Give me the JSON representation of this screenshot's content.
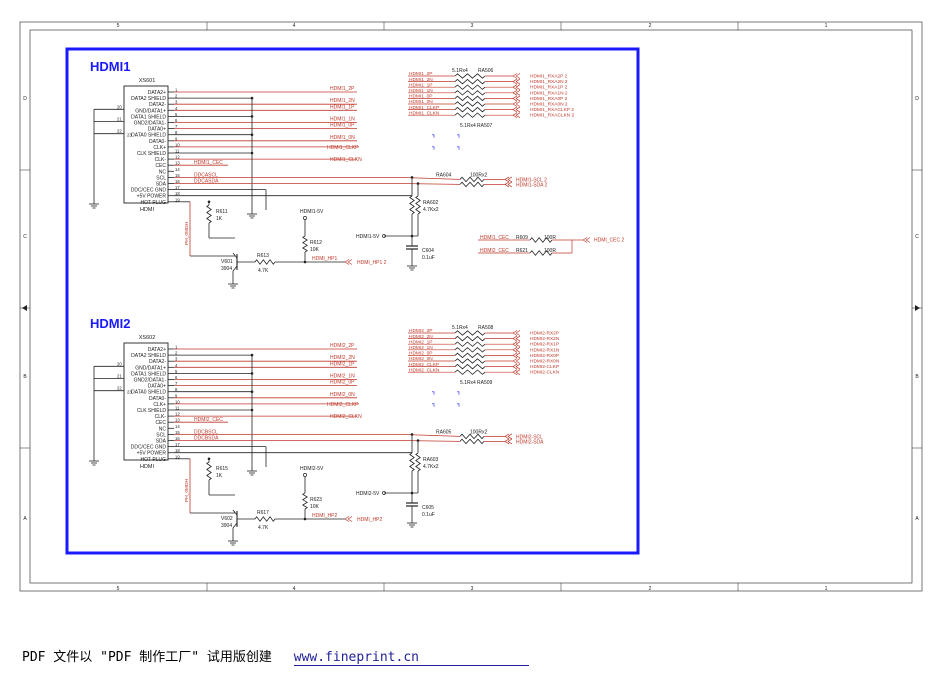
{
  "frame": {
    "top_cols": [
      "5",
      "4",
      "3",
      "2",
      "1"
    ],
    "bottom_cols": [
      "5",
      "4",
      "3",
      "2",
      "1"
    ],
    "rows": [
      "D",
      "C",
      "B",
      "A"
    ]
  },
  "blocks": [
    {
      "title": "HDMI1",
      "ref": "XS601",
      "part": "HDMI",
      "pins": [
        "DATA2+",
        "DATA2 SHIELD",
        "DATA2-",
        "GND/DATA1+",
        "DATA1 SHIELD",
        "GND2/DATA1-",
        "DATA0+",
        "DATA0 SHIELD",
        "DATA0-",
        "CLK+",
        "CLK SHIELD",
        "CLK-",
        "CEC",
        "NC",
        "SCL",
        "SDA",
        "DDC/CEC GND",
        "+5V POWER",
        "HOT PLUG"
      ],
      "nums": [
        "1",
        "2",
        "3",
        "4",
        "5",
        "6",
        "7",
        "8",
        "9",
        "10",
        "11",
        "12",
        "13",
        "14",
        "15",
        "16",
        "17",
        "18",
        "19"
      ],
      "gnd_nums": [
        "20",
        "21",
        "22",
        "23"
      ],
      "nets": [
        "HDMI1_2P",
        "HDMI1_2N",
        "HDMI1_1P",
        "HDMI1_1N",
        "HDMI1_0P",
        "HDMI1_0N",
        "HDMI1_CLKP",
        "HDMI1_CLKN"
      ],
      "pin_labels": [
        "HDMI1_CEC",
        "DDCASCL",
        "DDCASDA"
      ],
      "ra_top": {
        "value": "5.1Rx4",
        "ref": "RA506"
      },
      "ra_bot": {
        "value": "5.1Rx4",
        "ref": "RA507"
      },
      "ra_left": [
        "HDMI1_2P",
        "HDMI1_2N",
        "HDMI1_1P",
        "HDMI1_1N",
        "HDMI1_0P",
        "HDMI1_0N",
        "HDMI1_CLKP",
        "HDMI1_CLKN"
      ],
      "ra_right": [
        "HDMI1_RXA2P  2",
        "HDMI1_RXA2N  2",
        "HDMI1_RXA1P  2",
        "HDMI1_RXA1N  2",
        "HDMI1_RXA0P  2",
        "HDMI1_RXA0N  2",
        "HDMI1_RXACLKP  2",
        "HDMI1_RXACLKN  2"
      ],
      "ra_ddc": {
        "ref": "RA604",
        "value": "100Rx2",
        "out": [
          "HDMI1-SCL 2",
          "HDMI1-SDA 2"
        ]
      },
      "ra_pu": {
        "ref": "RA602",
        "value": "4.7Kx2"
      },
      "rail": "HDMI1-5V",
      "rail_in": "HDMI1-5V",
      "cap": {
        "ref": "C604",
        "value": "0.1uF"
      },
      "r_hp": {
        "ref": "R611",
        "value": "1K"
      },
      "r_pu": {
        "ref": "R612",
        "value": "10K"
      },
      "r_base": {
        "ref": "R613",
        "value": "4.7K"
      },
      "q": {
        "ref": "V601",
        "value": "3904"
      },
      "hp_net": "HDMI_HP1",
      "hp_out": "HDMI_HP1   2",
      "ph": "PH_0MDH",
      "cec_rows": [
        {
          "net": "HDMI1_CEC",
          "ref": "R609",
          "value": "100R"
        },
        {
          "net": "HDMI2_CEC",
          "ref": "R621",
          "value": "100R"
        }
      ],
      "cec_out": "HDMI_CEC   2"
    },
    {
      "title": "HDMI2",
      "ref": "XS602",
      "part": "HDMI",
      "pins": [
        "DATA2+",
        "DATA2 SHIELD",
        "DATA2-",
        "GND/DATA1+",
        "DATA1 SHIELD",
        "GND2/DATA1-",
        "DATA0+",
        "DATA0 SHIELD",
        "DATA0-",
        "CLK+",
        "CLK SHIELD",
        "CLK-",
        "CEC",
        "NC",
        "SCL",
        "SDA",
        "DDC/CEC GND",
        "+5V POWER",
        "HOT PLUG"
      ],
      "nums": [
        "1",
        "2",
        "3",
        "4",
        "5",
        "6",
        "7",
        "8",
        "9",
        "10",
        "11",
        "12",
        "13",
        "14",
        "15",
        "16",
        "17",
        "18",
        "19"
      ],
      "gnd_nums": [
        "20",
        "21",
        "22",
        "23"
      ],
      "nets": [
        "HDMI2_2P",
        "HDMI2_2N",
        "HDMI2_1P",
        "HDMI2_1N",
        "HDMI2_0P",
        "HDMI2_0N",
        "HDMI2_CLKP",
        "HDMI2_CLKN"
      ],
      "pin_labels": [
        "HDMI2_CEC",
        "DDCBSCL",
        "DDCBSDA"
      ],
      "ra_top": {
        "value": "5.1Rx4",
        "ref": "RA508"
      },
      "ra_bot": {
        "value": "5.1Rx4",
        "ref": "RA509"
      },
      "ra_left": [
        "HDMI2_2P",
        "HDMI2_2N",
        "HDMI2_1P",
        "HDMI2_1N",
        "HDMI2_0P",
        "HDMI2_0N",
        "HDMI2_CLKP",
        "HDMI2_CLKN"
      ],
      "ra_right": [
        "HDMI2-RX2P",
        "HDMI2-RX2N",
        "HDMI2-RX1P",
        "HDMI2-RX1N",
        "HDMI2-RX0P",
        "HDMI2-RX0N",
        "HDMI2-CLKP",
        "HDMI2-CLKN"
      ],
      "ra_ddc": {
        "ref": "RA605",
        "value": "100Rx2",
        "out": [
          "HDMI2-SCL",
          "HDMI2-SDA"
        ]
      },
      "ra_pu": {
        "ref": "RA603",
        "value": "4.7Kx2"
      },
      "rail": "HDMI2-5V",
      "rail_in": "HDMI2-5V",
      "cap": {
        "ref": "C605",
        "value": "0.1uF"
      },
      "r_hp": {
        "ref": "R615",
        "value": "1K"
      },
      "r_pu": {
        "ref": "R623",
        "value": "10K"
      },
      "r_base": {
        "ref": "R617",
        "value": "4.7K"
      },
      "q": {
        "ref": "V602",
        "value": "3904"
      },
      "hp_net": "HDMI_HP2",
      "hp_out": "HDMI_HP2",
      "ph": "PH_0MDH",
      "cec_rows": [],
      "cec_out": ""
    }
  ],
  "footer": {
    "text": "PDF 文件以 \"PDF 制作工厂\" 试用版创建",
    "link": "www.fineprint.cn"
  }
}
